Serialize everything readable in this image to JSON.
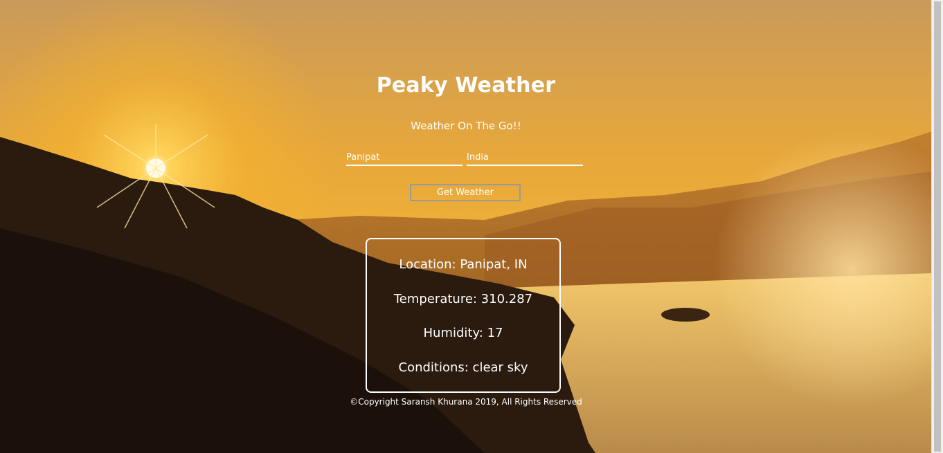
{
  "header": {
    "title": "Peaky Weather",
    "tagline": "Weather On The Go!!"
  },
  "form": {
    "city_value": "Panipat",
    "country_value": "India",
    "submit_label": "Get Weather"
  },
  "result": {
    "location": "Location: Panipat, IN",
    "temperature": "Temperature: 310.287",
    "humidity": "Humidity: 17",
    "conditions": "Conditions: clear sky"
  },
  "footer": {
    "copyright": "©Copyright Saransh Khurana 2019, All Rights Reserved"
  },
  "colors": {
    "text": "#ffffff",
    "sky_top": "#c9a063",
    "sun": "#fff3c4",
    "hills": "#2a1a10",
    "river": "#e9b55a"
  }
}
